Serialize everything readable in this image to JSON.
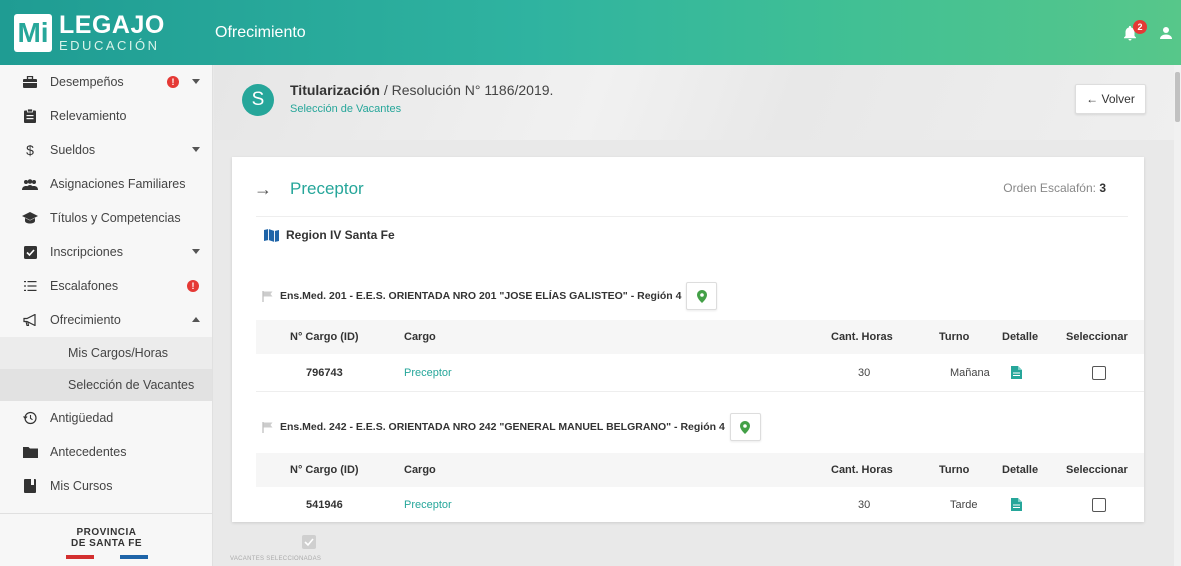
{
  "app": {
    "logo_mi": "Mi",
    "logo_title": "LEGAJO",
    "logo_subtitle": "EDUCACIÓN",
    "section": "Ofrecimiento",
    "notification_count": "2",
    "accent_color": "#26a69a"
  },
  "sidebar": {
    "items": [
      {
        "label": "Desempeños",
        "icon": "briefcase-icon",
        "alert": "!",
        "caret": "down"
      },
      {
        "label": "Relevamiento",
        "icon": "clipboard-icon"
      },
      {
        "label": "Sueldos",
        "icon": "dollar-icon",
        "caret": "down"
      },
      {
        "label": "Asignaciones Familiares",
        "icon": "people-icon"
      },
      {
        "label": "Títulos y Competencias",
        "icon": "graduation-cap-icon"
      },
      {
        "label": "Inscripciones",
        "icon": "checkbox-icon",
        "caret": "down"
      },
      {
        "label": "Escalafones",
        "icon": "list-icon",
        "alert": "!"
      },
      {
        "label": "Ofrecimiento",
        "icon": "megaphone-icon",
        "caret": "up"
      },
      {
        "label": "Antigüedad",
        "icon": "history-icon"
      },
      {
        "label": "Antecedentes",
        "icon": "folder-icon"
      },
      {
        "label": "Mis Cursos",
        "icon": "book-icon"
      }
    ],
    "subitems": [
      {
        "label": "Mis Cargos/Horas"
      },
      {
        "label": "Selección de Vacantes"
      }
    ],
    "footer_line1": "PROVINCIA",
    "footer_line2": "DE SANTA FE"
  },
  "header": {
    "avatar_letter": "S",
    "title_bold": "Titularización",
    "title_rest": " / Resolución N° 1186/2019.",
    "subtitle": "Selección de Vacantes",
    "back_label": "← Volver"
  },
  "card": {
    "arrow": "→",
    "title": "Preceptor",
    "orden_label": "Orden Escalafón: ",
    "orden_value": "3",
    "region": "Region IV Santa Fe",
    "columns": [
      "N° Cargo (ID)",
      "Cargo",
      "Cant. Horas",
      "Turno",
      "Detalle",
      "Seleccionar"
    ],
    "schools": [
      {
        "name": "Ens.Med. 201 - E.E.S. ORIENTADA NRO 201 \"JOSE ELÍAS GALISTEO\" - Región 4",
        "rows": [
          {
            "id": "796743",
            "cargo": "Preceptor",
            "horas": "30",
            "turno": "Mañana"
          }
        ]
      },
      {
        "name": "Ens.Med. 242 - E.E.S. ORIENTADA NRO 242 \"GENERAL MANUEL BELGRANO\" - Región 4",
        "rows": [
          {
            "id": "541946",
            "cargo": "Preceptor",
            "horas": "30",
            "turno": "Tarde"
          }
        ]
      }
    ]
  },
  "footer": {
    "vacantes_label": "VACANTES SELECCIONADAS"
  }
}
